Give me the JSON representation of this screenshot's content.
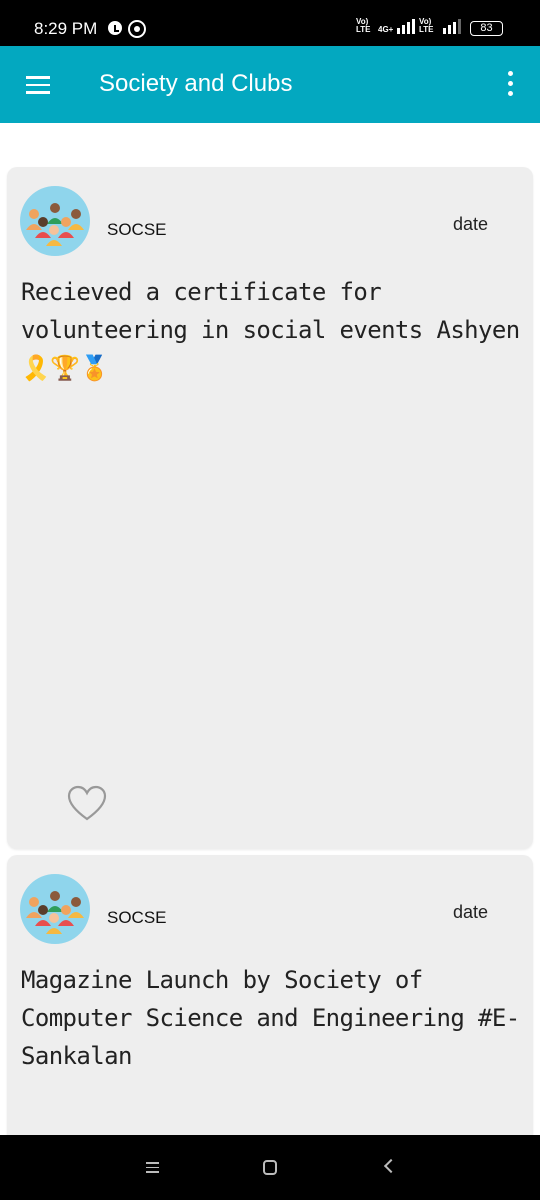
{
  "status_bar": {
    "time": "8:29 PM",
    "network_1": "Vo) LTE",
    "network_1_type": "4G+",
    "network_2": "Vo) LTE",
    "battery": "83",
    "icons": [
      "alarm-icon",
      "whatsapp-icon",
      "signal-icon",
      "battery-icon"
    ]
  },
  "app_bar": {
    "title": "Society and Clubs",
    "menu_icon": "hamburger-menu-icon",
    "more_icon": "more-vertical-icon",
    "color": "#03a8c0"
  },
  "posts": [
    {
      "author": "SOCSE",
      "date": "date",
      "text": "Recieved a certificate for volunteering in social events Ashyen🎗️🏆🏅",
      "like_icon": "heart-outline-icon"
    },
    {
      "author": "SOCSE",
      "date": "date",
      "text": "Magazine Launch by Society of Computer Science and Engineering #E-Sankalan"
    }
  ],
  "nav_bar": {
    "icons": [
      "recent-apps-icon",
      "home-icon",
      "back-icon"
    ]
  }
}
